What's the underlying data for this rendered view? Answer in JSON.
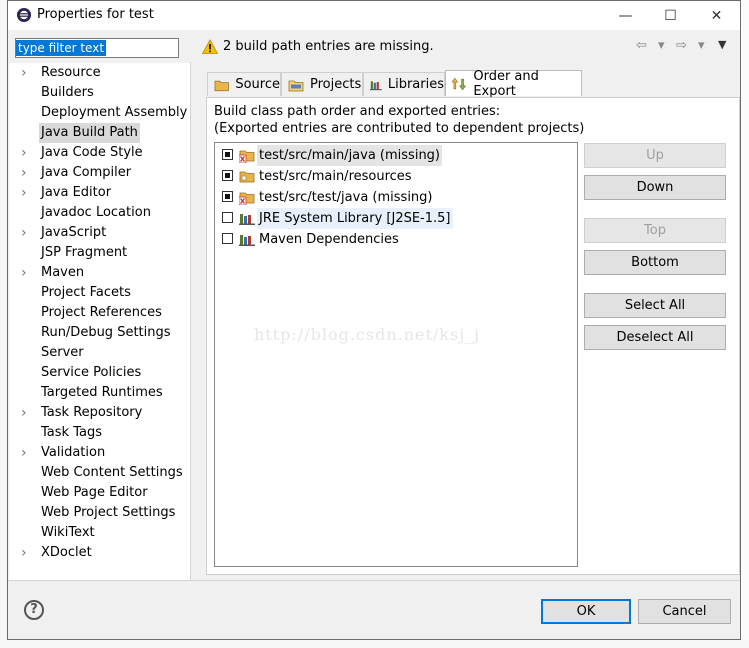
{
  "window": {
    "title": "Properties for test",
    "minimize_glyph": "—",
    "maximize_glyph": "☐",
    "close_glyph": "✕"
  },
  "filter": {
    "value": "type filter text"
  },
  "message": "2 build path entries are missing.",
  "nav": {
    "back": "⇦",
    "dropdown": "▾",
    "forward": "⇨",
    "menu": "▼"
  },
  "sidebar": {
    "items": [
      {
        "label": "Resource",
        "expandable": true
      },
      {
        "label": "Builders",
        "expandable": false
      },
      {
        "label": "Deployment Assembly",
        "expandable": false
      },
      {
        "label": "Java Build Path",
        "expandable": false,
        "selected": true
      },
      {
        "label": "Java Code Style",
        "expandable": true
      },
      {
        "label": "Java Compiler",
        "expandable": true
      },
      {
        "label": "Java Editor",
        "expandable": true
      },
      {
        "label": "Javadoc Location",
        "expandable": false
      },
      {
        "label": "JavaScript",
        "expandable": true
      },
      {
        "label": "JSP Fragment",
        "expandable": false
      },
      {
        "label": "Maven",
        "expandable": true
      },
      {
        "label": "Project Facets",
        "expandable": false
      },
      {
        "label": "Project References",
        "expandable": false
      },
      {
        "label": "Run/Debug Settings",
        "expandable": false
      },
      {
        "label": "Server",
        "expandable": false
      },
      {
        "label": "Service Policies",
        "expandable": false
      },
      {
        "label": "Targeted Runtimes",
        "expandable": false
      },
      {
        "label": "Task Repository",
        "expandable": true
      },
      {
        "label": "Task Tags",
        "expandable": false
      },
      {
        "label": "Validation",
        "expandable": true
      },
      {
        "label": "Web Content Settings",
        "expandable": false
      },
      {
        "label": "Web Page Editor",
        "expandable": false
      },
      {
        "label": "Web Project Settings",
        "expandable": false
      },
      {
        "label": "WikiText",
        "expandable": false
      },
      {
        "label": "XDoclet",
        "expandable": true
      }
    ]
  },
  "tabs": [
    {
      "label": "Source"
    },
    {
      "label": "Projects"
    },
    {
      "label": "Libraries"
    },
    {
      "label": "Order and Export",
      "active": true
    }
  ],
  "content": {
    "description_line1": "Build class path order and exported entries:",
    "description_line2": "(Exported entries are contributed to dependent projects)",
    "entries": [
      {
        "label": "test/src/main/java (missing)",
        "checked": true,
        "icon": "source-folder-missing-icon"
      },
      {
        "label": "test/src/main/resources",
        "checked": true,
        "icon": "source-folder-icon"
      },
      {
        "label": "test/src/test/java (missing)",
        "checked": true,
        "icon": "source-folder-missing-icon"
      },
      {
        "label": "JRE System Library [J2SE-1.5]",
        "checked": false,
        "icon": "library-icon"
      },
      {
        "label": "Maven Dependencies",
        "checked": false,
        "icon": "library-icon"
      }
    ]
  },
  "buttons": {
    "up": "Up",
    "down": "Down",
    "top": "Top",
    "bottom": "Bottom",
    "select_all": "Select All",
    "deselect_all": "Deselect All",
    "ok": "OK",
    "cancel": "Cancel",
    "help": "?"
  },
  "watermark": "http://blog.csdn.net/ksj_j",
  "colors": {
    "selection_blue": "#0078d7",
    "warning_yellow": "#f2c200",
    "folder_yellow": "#e8b54a",
    "error_red": "#d32f2f"
  }
}
